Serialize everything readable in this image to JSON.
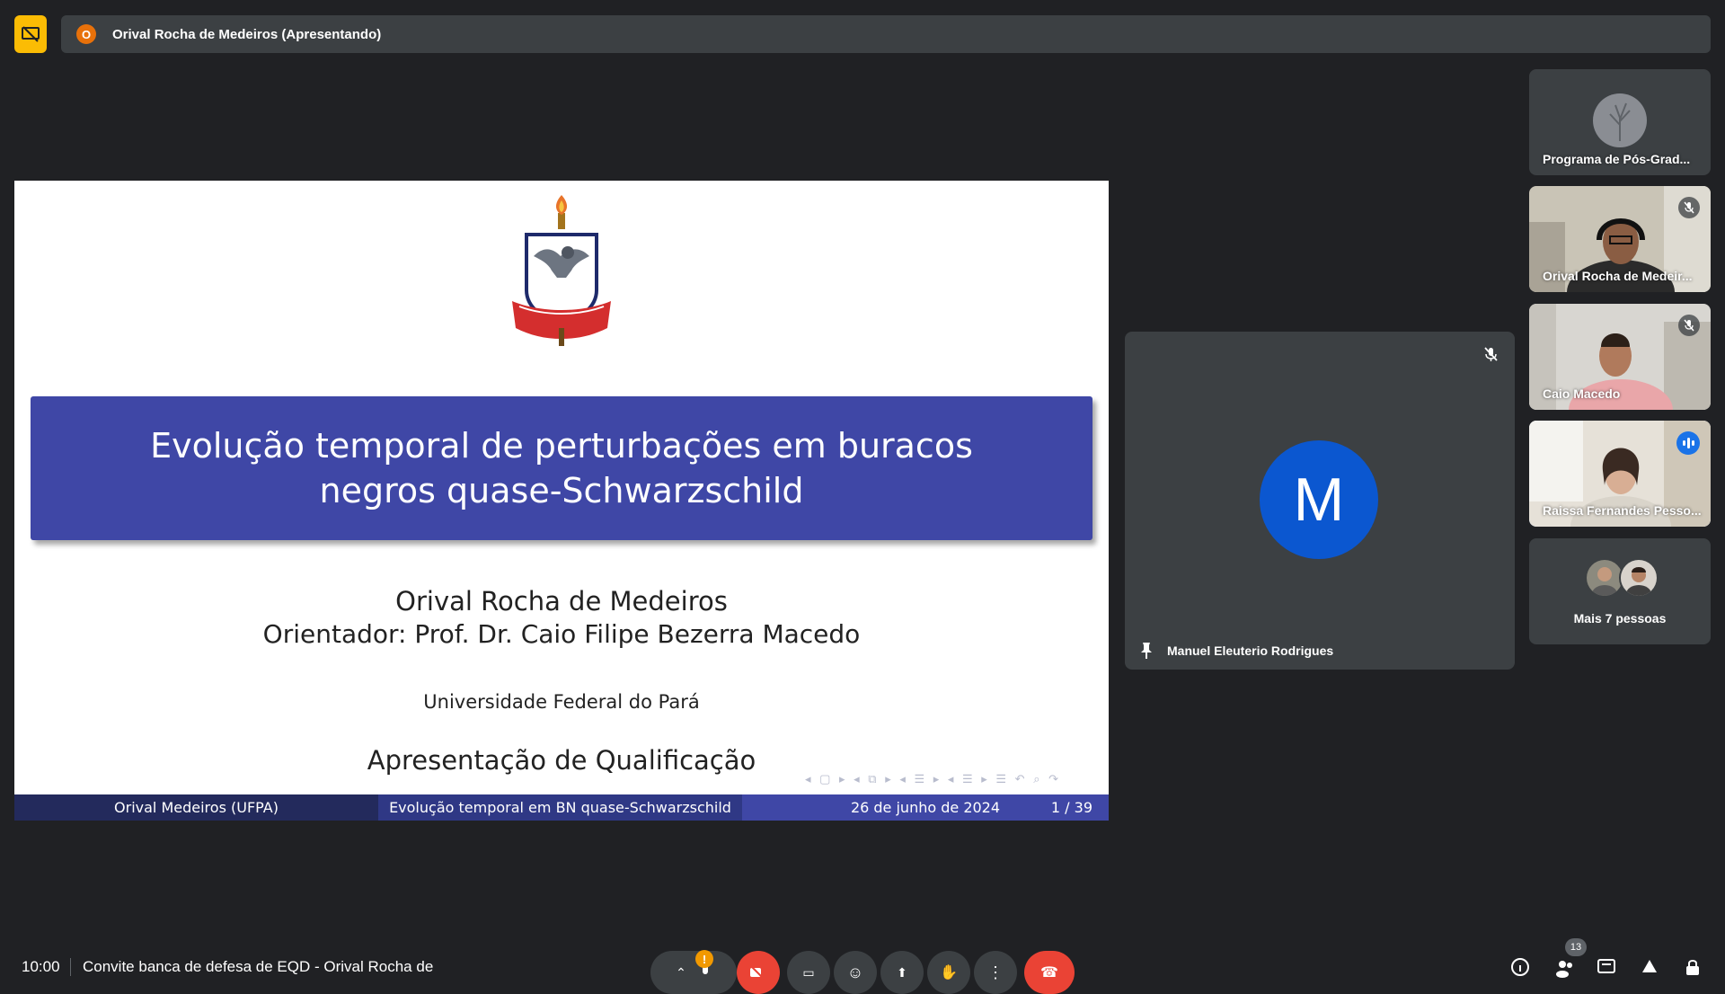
{
  "header": {
    "presenter_badge": "O",
    "presenter_label": "Orival Rocha de Medeiros (Apresentando)"
  },
  "slide": {
    "title": "Evolução temporal de perturbações em buracos negros quase-Schwarzschild",
    "author": "Orival Rocha de Medeiros",
    "advisor": "Orientador: Prof. Dr. Caio Filipe Bezerra Macedo",
    "university": "Universidade Federal do Pará",
    "event": "Apresentação de Qualificação",
    "footer": {
      "author": "Orival Medeiros  (UFPA)",
      "short_title": "Evolução temporal em BN quase-Schwarzschild",
      "date": "26 de junho de 2024",
      "page": "1 / 39"
    },
    "colors": {
      "title_box": "#3f47a6",
      "footer_dark": "#232a5c",
      "footer_mid": "#2f3885"
    }
  },
  "main_tile": {
    "avatar_letter": "M",
    "name": "Manuel Eleuterio Rodrigues",
    "avatar_color": "#0b57d0"
  },
  "participants": [
    {
      "name": "Programa de Pós-Grad..."
    },
    {
      "name": "Orival Rocha de Medeir..."
    },
    {
      "name": "Caio Macedo"
    },
    {
      "name": "Raissa Fernandes Pesso..."
    }
  ],
  "more": {
    "label": "Mais 7 pessoas"
  },
  "bottom": {
    "time": "10:00",
    "meeting_title": "Convite banca de defesa de EQD - Orival Rocha de",
    "alert": "!",
    "people_count": "13"
  }
}
